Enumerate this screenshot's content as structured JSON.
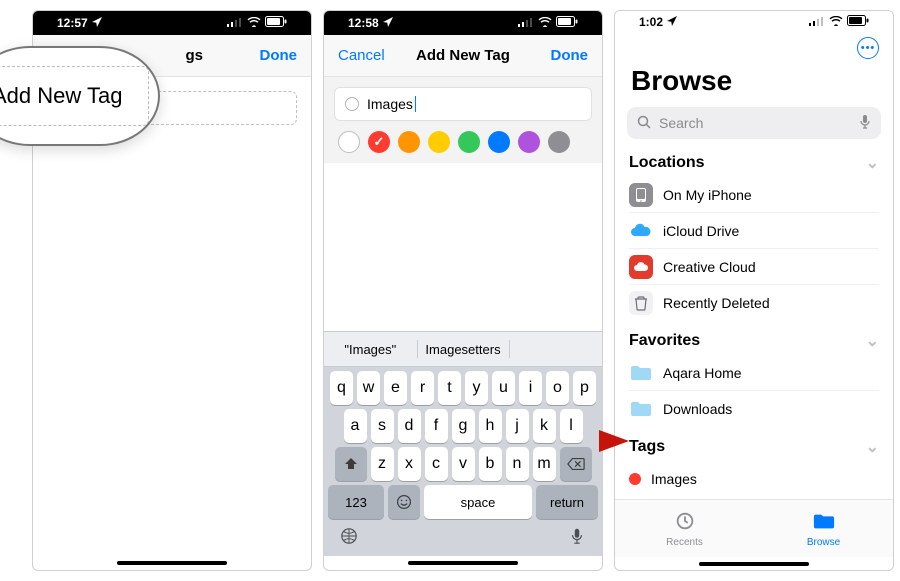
{
  "screen1": {
    "status_time": "12:57",
    "nav_title_suffix": "gs",
    "nav_done": "Done",
    "magnifier_text": "Add New Tag"
  },
  "screen2": {
    "status_time": "12:58",
    "nav_cancel": "Cancel",
    "nav_title": "Add New Tag",
    "nav_done": "Done",
    "tag_input_value": "Images",
    "colors": [
      {
        "name": "none",
        "hex": "#ffffff",
        "hollow": true,
        "selected": false
      },
      {
        "name": "red",
        "hex": "#ff3b30",
        "hollow": false,
        "selected": true
      },
      {
        "name": "orange",
        "hex": "#ff9500",
        "hollow": false,
        "selected": false
      },
      {
        "name": "yellow",
        "hex": "#ffcc00",
        "hollow": false,
        "selected": false
      },
      {
        "name": "green",
        "hex": "#34c759",
        "hollow": false,
        "selected": false
      },
      {
        "name": "blue",
        "hex": "#007aff",
        "hollow": false,
        "selected": false
      },
      {
        "name": "purple",
        "hex": "#af52de",
        "hollow": false,
        "selected": false
      },
      {
        "name": "grey",
        "hex": "#8e8e93",
        "hollow": false,
        "selected": false
      }
    ],
    "keyboard": {
      "suggestions": [
        "\"Images\"",
        "Imagesetters",
        ""
      ],
      "row1": [
        "q",
        "w",
        "e",
        "r",
        "t",
        "y",
        "u",
        "i",
        "o",
        "p"
      ],
      "row2": [
        "a",
        "s",
        "d",
        "f",
        "g",
        "h",
        "j",
        "k",
        "l"
      ],
      "row3_letters": [
        "z",
        "x",
        "c",
        "v",
        "b",
        "n",
        "m"
      ],
      "mode": "123",
      "space": "space",
      "return": "return"
    }
  },
  "screen3": {
    "status_time": "1:02",
    "page_title": "Browse",
    "search_placeholder": "Search",
    "sections": {
      "locations": {
        "title": "Locations",
        "items": [
          "On My iPhone",
          "iCloud Drive",
          "Creative Cloud",
          "Recently Deleted"
        ]
      },
      "favorites": {
        "title": "Favorites",
        "items": [
          "Aqara Home",
          "Downloads"
        ]
      },
      "tags": {
        "title": "Tags",
        "items": [
          {
            "label": "Images",
            "color": "#ff3b30"
          }
        ]
      }
    },
    "tabs": {
      "recents": "Recents",
      "browse": "Browse"
    }
  }
}
